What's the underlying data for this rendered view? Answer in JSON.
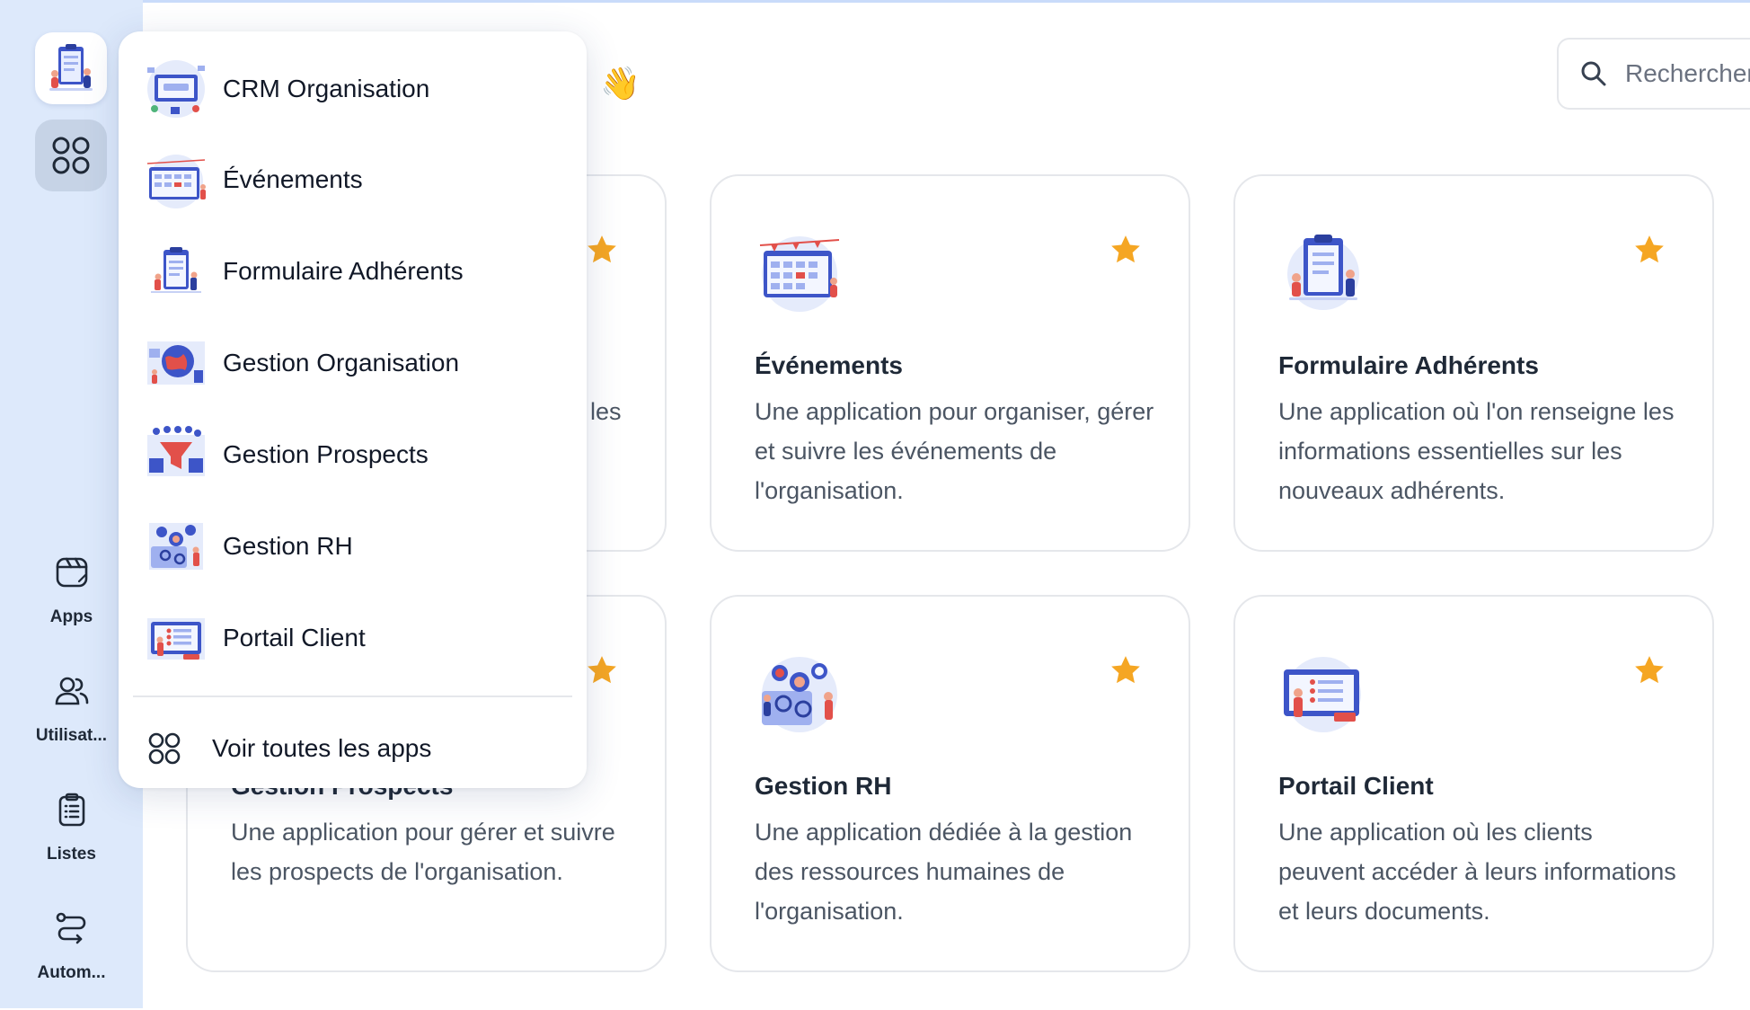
{
  "header": {
    "emoji": "👋",
    "search_placeholder": "Rechercher"
  },
  "sidebar": {
    "nav": [
      {
        "label": "Apps",
        "icon": "apps-window-icon"
      },
      {
        "label": "Utilisat...",
        "icon": "users-icon"
      },
      {
        "label": "Listes",
        "icon": "clipboard-list-icon"
      },
      {
        "label": "Autom...",
        "icon": "route-automation-icon"
      }
    ]
  },
  "dropdown": {
    "items": [
      {
        "label": "CRM Organisation"
      },
      {
        "label": "Événements"
      },
      {
        "label": "Formulaire Adhérents"
      },
      {
        "label": "Gestion Organisation"
      },
      {
        "label": "Gestion Prospects"
      },
      {
        "label": "Gestion RH"
      },
      {
        "label": "Portail Client"
      }
    ],
    "all_apps_label": "Voir toutes les apps"
  },
  "cards": [
    {
      "title": "",
      "desc": "les",
      "starred": true
    },
    {
      "title": "Événements",
      "desc": "Une application pour organiser, gérer et suivre les événements de l'organisation.",
      "starred": true
    },
    {
      "title": "Formulaire Adhérents",
      "desc": "Une application où l'on renseigne les informations essentielles sur les nouveaux adhérents.",
      "starred": true
    },
    {
      "title": "Gestion Prospects",
      "desc": "Une application pour gérer et suivre les prospects de l'organisation.",
      "starred": true
    },
    {
      "title": "Gestion RH",
      "desc": "Une application dédiée à la gestion des ressources humaines de l'organisation.",
      "starred": true
    },
    {
      "title": "Portail Client",
      "desc": "Une application où les clients peuvent accéder à leurs informations et leurs documents.",
      "starred": true
    }
  ],
  "colors": {
    "sidebar_bg": "#dde9fb",
    "star": "#f5a623",
    "accent": "#4f6cf0"
  }
}
